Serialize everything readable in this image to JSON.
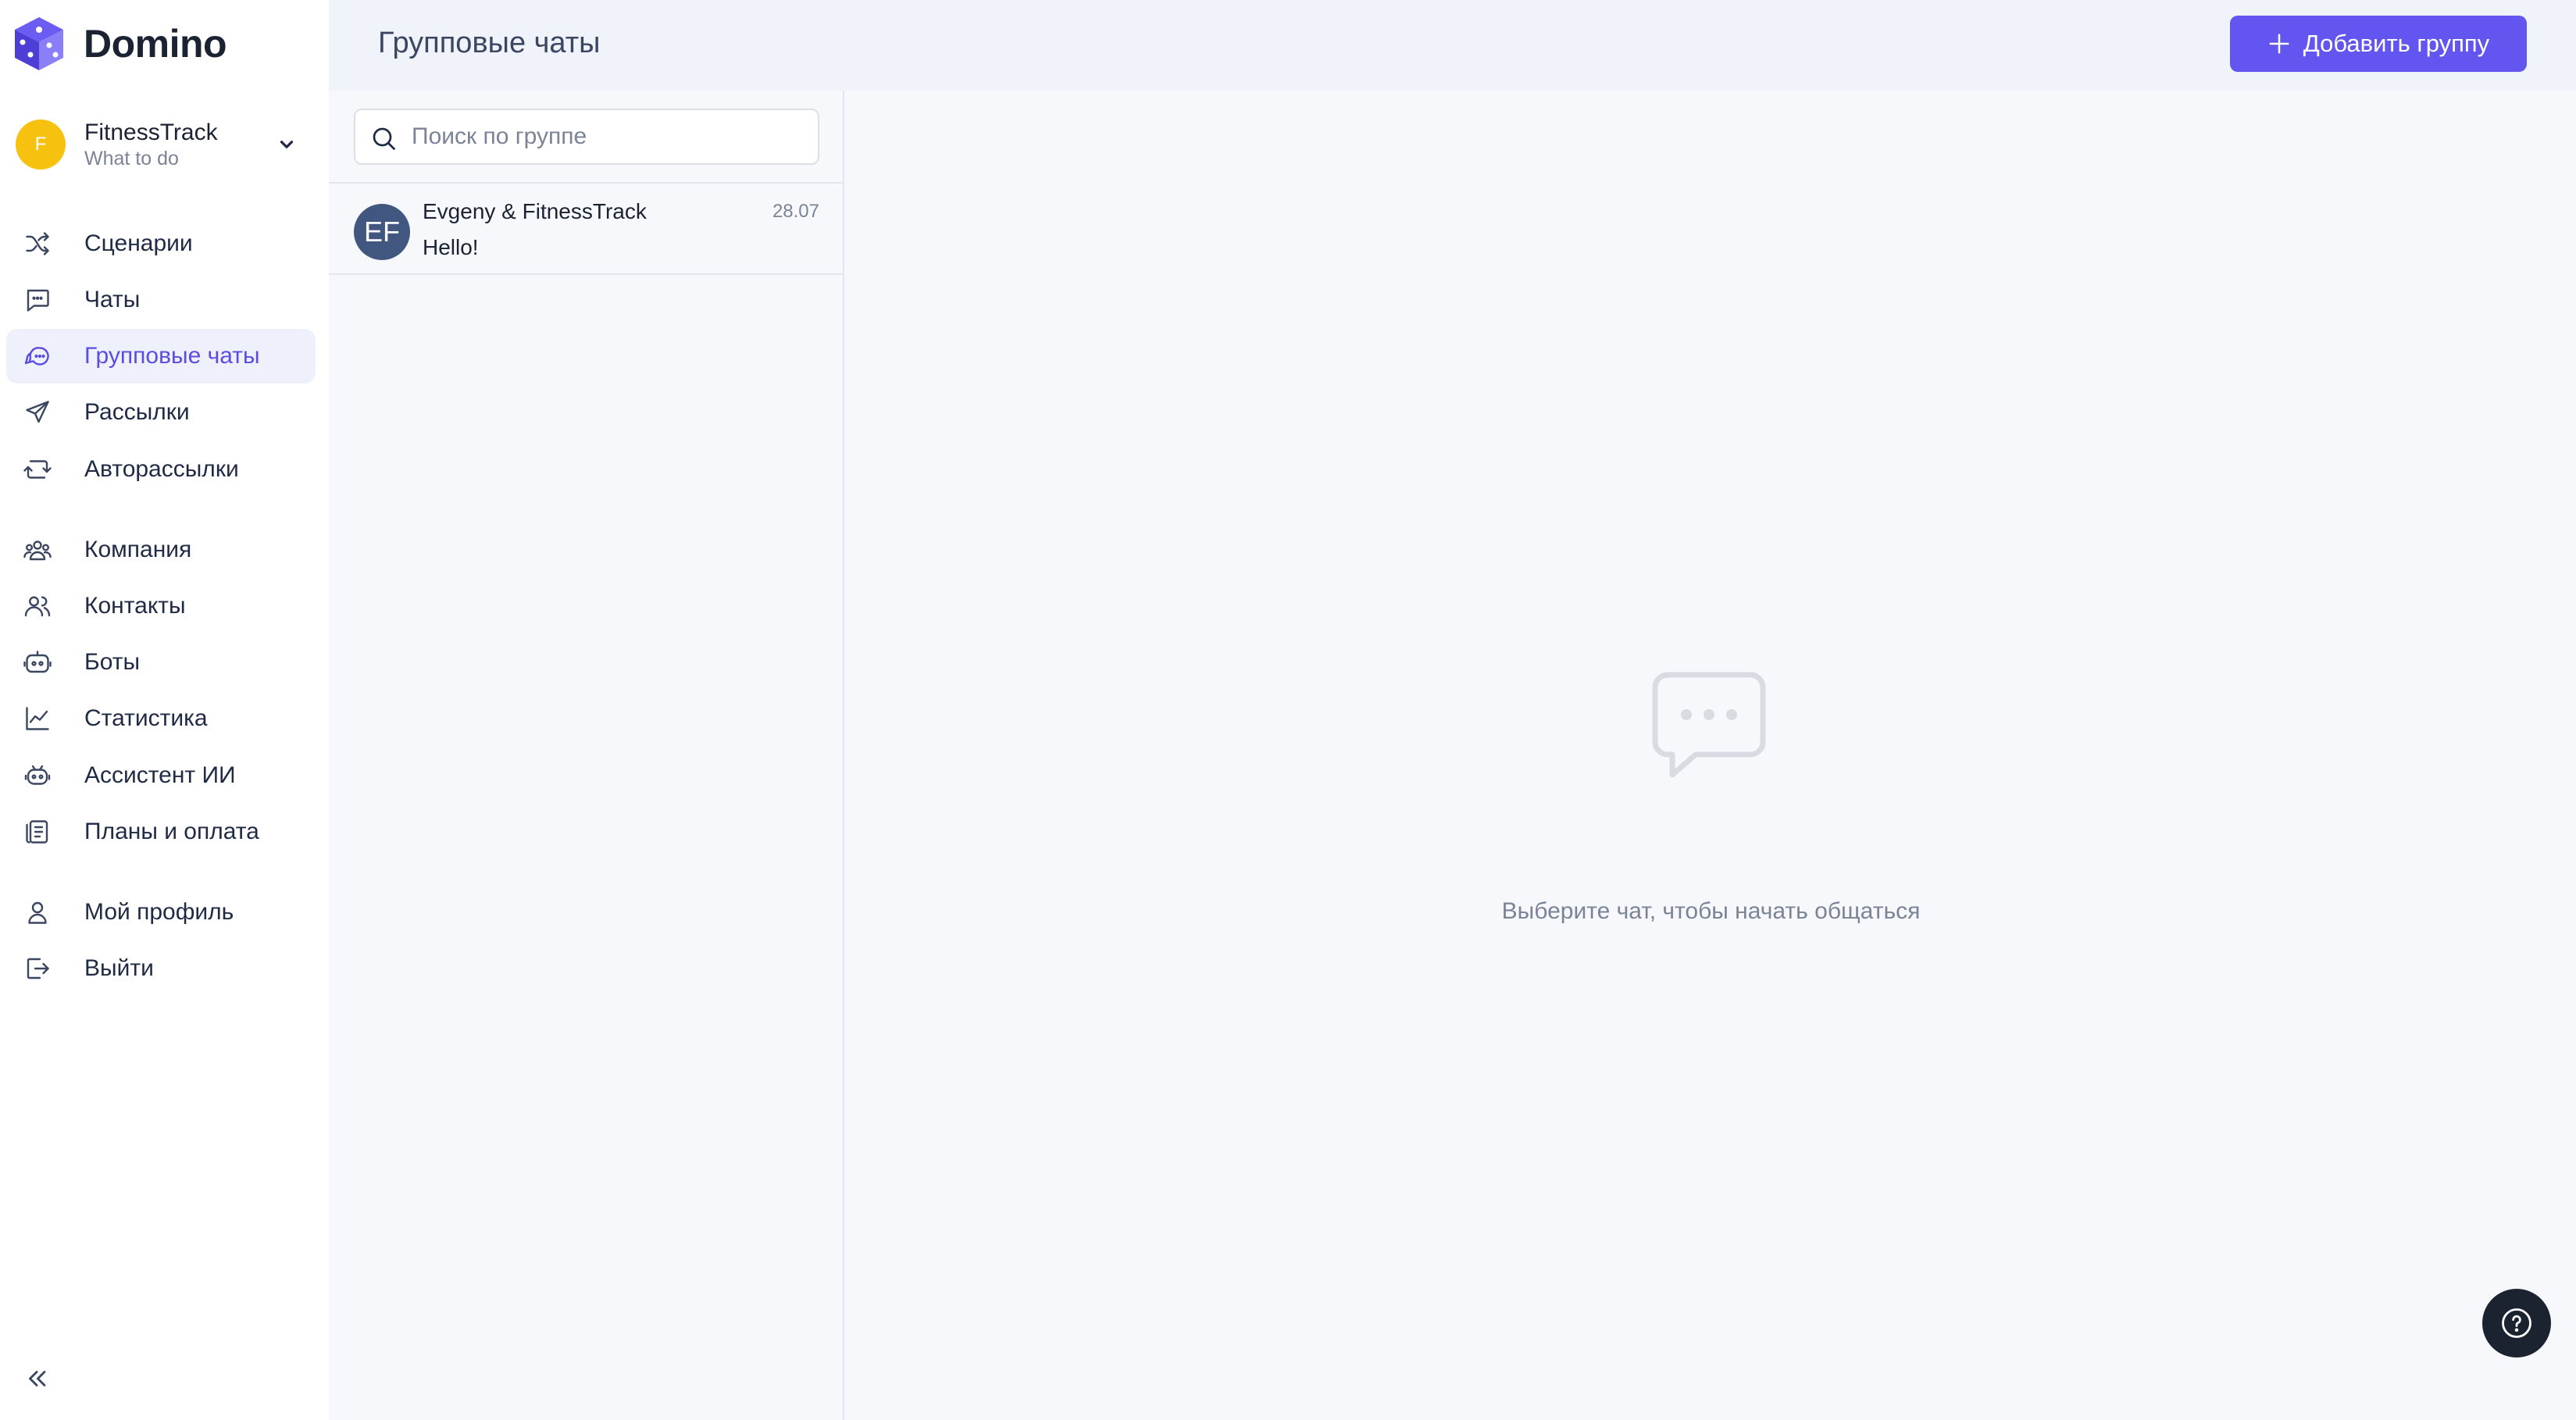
{
  "app": {
    "name": "Domino"
  },
  "org": {
    "initial": "F",
    "name": "FitnessTrack",
    "subtitle": "What to do"
  },
  "sidebar": {
    "items": [
      {
        "label": "Сценарии",
        "icon": "shuffle-icon"
      },
      {
        "label": "Чаты",
        "icon": "chat-icon"
      },
      {
        "label": "Групповые чаты",
        "icon": "group-chat-icon",
        "active": true
      },
      {
        "label": "Рассылки",
        "icon": "send-icon"
      },
      {
        "label": "Авторассылки",
        "icon": "auto-send-icon"
      },
      {
        "label": "Компания",
        "icon": "company-icon"
      },
      {
        "label": "Контакты",
        "icon": "contacts-icon"
      },
      {
        "label": "Боты",
        "icon": "bot-icon"
      },
      {
        "label": "Статистика",
        "icon": "chart-icon"
      },
      {
        "label": "Ассистент ИИ",
        "icon": "ai-assistant-icon"
      },
      {
        "label": "Планы и оплата",
        "icon": "billing-icon"
      },
      {
        "label": "Мой профиль",
        "icon": "profile-icon"
      },
      {
        "label": "Выйти",
        "icon": "logout-icon"
      }
    ]
  },
  "header": {
    "title": "Групповые чаты",
    "add_button": "Добавить группу"
  },
  "search": {
    "placeholder": "Поиск по группе",
    "value": ""
  },
  "chats": [
    {
      "initials": "EF",
      "name": "Evgeny & FitnessTrack",
      "message": "Hello!",
      "date": "28.07"
    }
  ],
  "main": {
    "empty_text": "Выберите чат, чтобы начать общаться"
  },
  "colors": {
    "accent": "#6355f0",
    "active_bg": "#eef0fc",
    "org_avatar": "#f7c20f",
    "chat_avatar": "#41577f"
  }
}
